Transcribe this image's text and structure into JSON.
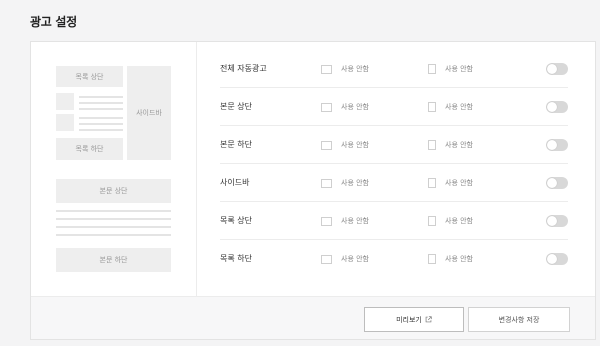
{
  "page": {
    "title": "광고 설정"
  },
  "preview": {
    "list_top": "목록 상단",
    "sidebar": "사이드바",
    "list_bottom": "목록 하단",
    "body_top": "본문 상단",
    "body_bottom": "본문 하단"
  },
  "settings": {
    "rows": [
      {
        "label": "전체 자동광고",
        "option1": "사용 안함",
        "option2": "사용 안함",
        "enabled": false
      },
      {
        "label": "본문 상단",
        "option1": "사용 안함",
        "option2": "사용 안함",
        "enabled": false
      },
      {
        "label": "본문 하단",
        "option1": "사용 안함",
        "option2": "사용 안함",
        "enabled": false
      },
      {
        "label": "사이드바",
        "option1": "사용 안함",
        "option2": "사용 안함",
        "enabled": false
      },
      {
        "label": "목록 상단",
        "option1": "사용 안함",
        "option2": "사용 안함",
        "enabled": false
      },
      {
        "label": "목록 하단",
        "option1": "사용 안함",
        "option2": "사용 안함",
        "enabled": false
      }
    ]
  },
  "footer": {
    "preview_label": "미리보기",
    "save_label": "변경사항 저장",
    "preview_icon": "external-link-icon"
  },
  "colors": {
    "toggle_off": "#d8d8d8",
    "placeholder": "#eeeeee"
  }
}
